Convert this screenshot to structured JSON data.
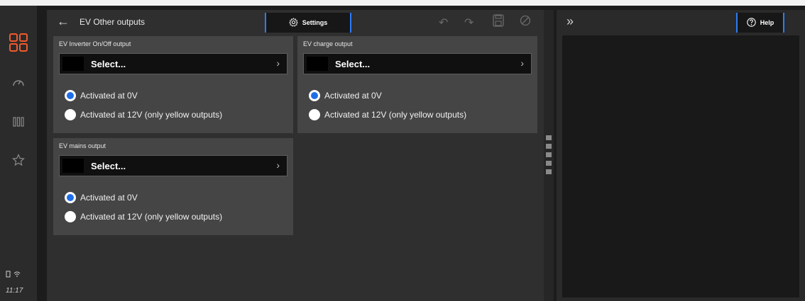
{
  "app": {
    "accent": "#f25a2c",
    "highlight": "#2d7cf6"
  },
  "nav": {
    "items": [
      {
        "name": "apps",
        "icon": "grid-icon"
      },
      {
        "name": "dashboard",
        "icon": "gauge-icon"
      },
      {
        "name": "panels",
        "icon": "columns-icon"
      },
      {
        "name": "favorites",
        "icon": "star-icon"
      }
    ],
    "time": "11:17"
  },
  "toolbar": {
    "title": "EV Other outputs",
    "settings_label": "Settings"
  },
  "panels": [
    {
      "title": "EV Inverter On/Off output",
      "select_label": "Select...",
      "options": [
        "Activated at 0V",
        "Activated at 12V (only yellow outputs)"
      ],
      "selected": 0
    },
    {
      "title": "EV charge output",
      "select_label": "Select...",
      "options": [
        "Activated at 0V",
        "Activated at 12V (only yellow outputs)"
      ],
      "selected": 0
    },
    {
      "title": "EV mains output",
      "select_label": "Select...",
      "options": [
        "Activated at 0V",
        "Activated at 12V (only yellow outputs)"
      ],
      "selected": 0
    }
  ],
  "help": {
    "label": "Help"
  }
}
